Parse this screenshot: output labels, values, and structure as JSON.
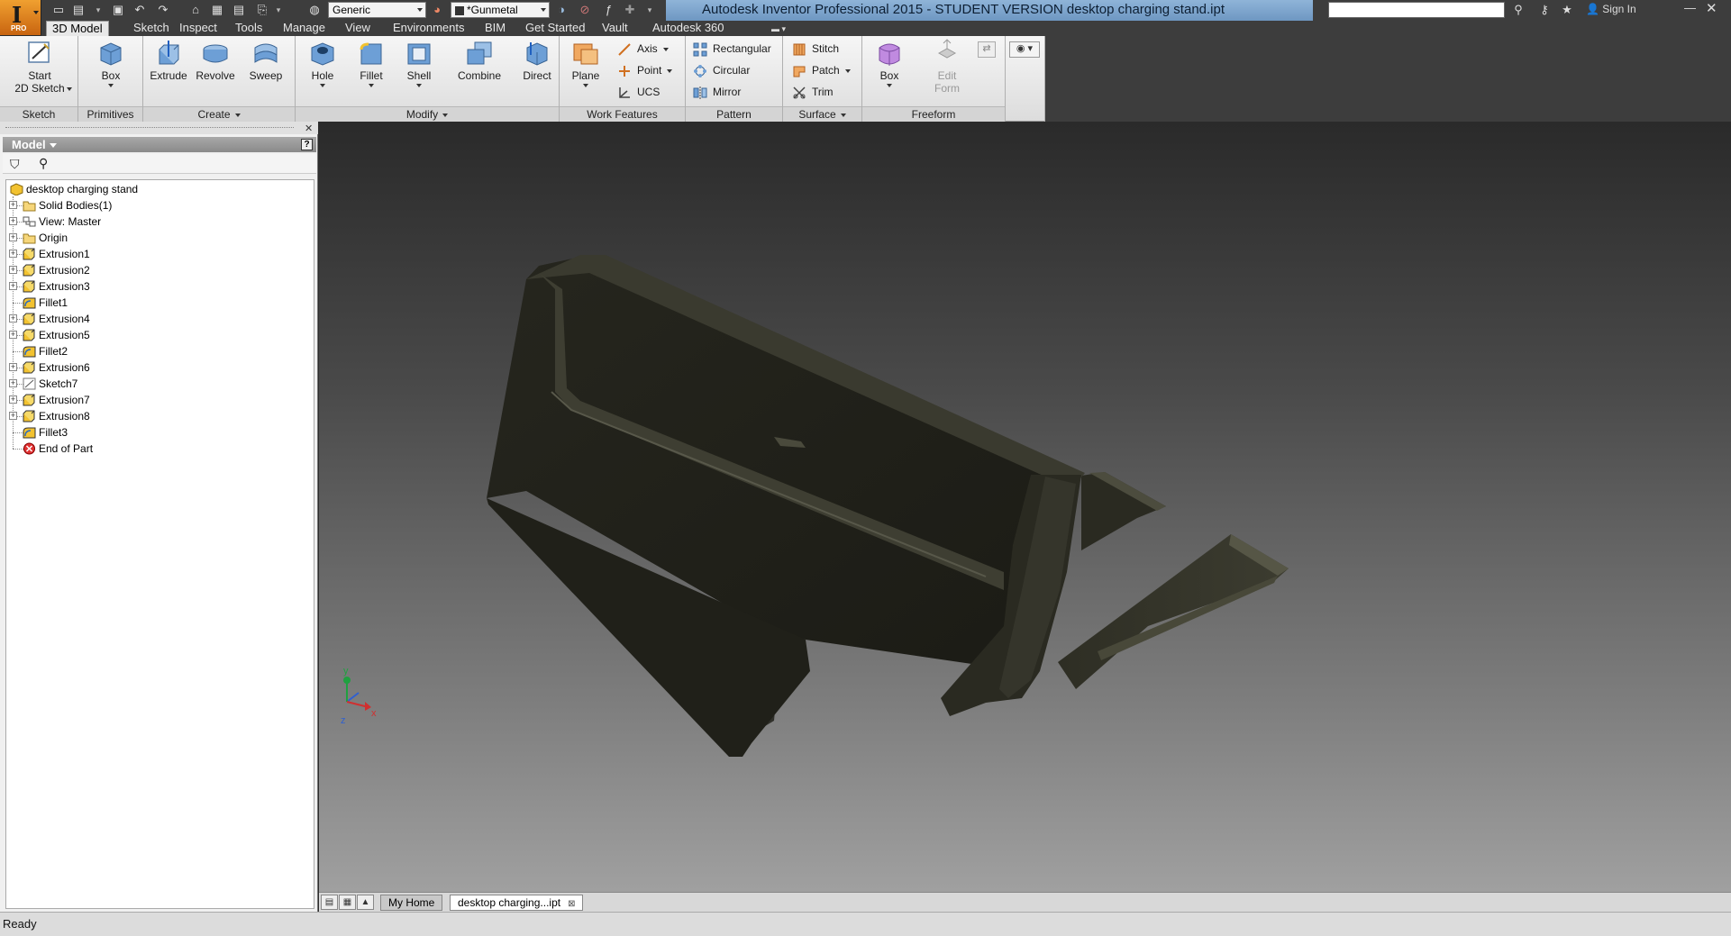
{
  "titlebar": {
    "app_letter": "I",
    "app_badge": "PRO",
    "material": "Generic",
    "appearance": "*Gunmetal",
    "title": "Autodesk Inventor Professional 2015 - STUDENT VERSION     desktop charging stand.ipt",
    "search_placeholder": "",
    "signin": "Sign In"
  },
  "tabs": [
    {
      "label": "3D Model",
      "active": true
    },
    {
      "label": "Sketch"
    },
    {
      "label": "Inspect"
    },
    {
      "label": "Tools"
    },
    {
      "label": "Manage"
    },
    {
      "label": "View"
    },
    {
      "label": "Environments"
    },
    {
      "label": "BIM"
    },
    {
      "label": "Get Started"
    },
    {
      "label": "Vault"
    },
    {
      "label": "Autodesk 360"
    }
  ],
  "ribbon": {
    "panels": {
      "sketch": "Sketch",
      "primitives": "Primitives",
      "create": "Create",
      "modify": "Modify",
      "work_features": "Work Features",
      "pattern": "Pattern",
      "surface": "Surface",
      "freeform": "Freeform"
    },
    "buttons": {
      "start_sketch_1": "Start",
      "start_sketch_2": "2D Sketch",
      "box": "Box",
      "extrude": "Extrude",
      "revolve": "Revolve",
      "sweep": "Sweep",
      "hole": "Hole",
      "fillet": "Fillet",
      "shell": "Shell",
      "combine": "Combine",
      "direct": "Direct",
      "plane": "Plane",
      "axis": "Axis",
      "point": "Point",
      "ucs": "UCS",
      "rectangular": "Rectangular",
      "circular": "Circular",
      "mirror": "Mirror",
      "stitch": "Stitch",
      "patch": "Patch",
      "trim": "Trim",
      "freeform_box": "Box",
      "edit_form_1": "Edit",
      "edit_form_2": "Form"
    }
  },
  "browser": {
    "header": "Model",
    "help": "?",
    "tree": [
      {
        "label": "desktop charging stand",
        "icon": "part-icon",
        "expander": false,
        "root": true
      },
      {
        "label": "Solid Bodies(1)",
        "icon": "folder-icon",
        "expander": true
      },
      {
        "label": "View: Master",
        "icon": "view-icon",
        "expander": true
      },
      {
        "label": "Origin",
        "icon": "folder-icon",
        "expander": true
      },
      {
        "label": "Extrusion1",
        "icon": "extrusion-icon",
        "expander": true
      },
      {
        "label": "Extrusion2",
        "icon": "extrusion-icon",
        "expander": true
      },
      {
        "label": "Extrusion3",
        "icon": "extrusion-icon",
        "expander": true
      },
      {
        "label": "Fillet1",
        "icon": "fillet-icon",
        "expander": false
      },
      {
        "label": "Extrusion4",
        "icon": "extrusion-icon",
        "expander": true
      },
      {
        "label": "Extrusion5",
        "icon": "extrusion-icon",
        "expander": true
      },
      {
        "label": "Fillet2",
        "icon": "fillet-icon",
        "expander": false
      },
      {
        "label": "Extrusion6",
        "icon": "extrusion-icon",
        "expander": true
      },
      {
        "label": "Sketch7",
        "icon": "sketch-icon",
        "expander": true
      },
      {
        "label": "Extrusion7",
        "icon": "extrusion-icon",
        "expander": true
      },
      {
        "label": "Extrusion8",
        "icon": "extrusion-icon",
        "expander": true
      },
      {
        "label": "Fillet3",
        "icon": "fillet-icon",
        "expander": false
      },
      {
        "label": "End of Part",
        "icon": "end-of-part-icon",
        "expander": false
      }
    ]
  },
  "viewport": {
    "triad": {
      "x": "x",
      "y": "y",
      "z": "z"
    }
  },
  "doc_tabs": {
    "home": "My Home",
    "active": "desktop charging...ipt"
  },
  "status": {
    "text": "Ready"
  },
  "colors": {
    "title_accent": "#7aa3cc",
    "model_color": "#3a3a2e"
  }
}
